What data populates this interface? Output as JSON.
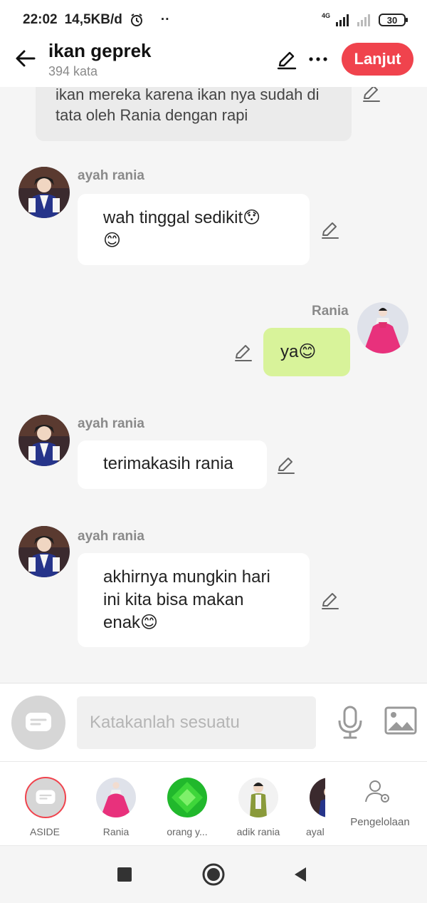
{
  "status_bar": {
    "time": "22:02",
    "speed": "14,5KB/d",
    "network": "4G",
    "battery": "30",
    "alarm_icon": "alarm-clock-icon",
    "dots": "··"
  },
  "header": {
    "title": "ikan geprek",
    "word_count": "394 kata",
    "next_label": "Lanjut"
  },
  "messages": [
    {
      "sender": "",
      "side": "left",
      "lines": [
        "ikan mereka karena ikan nya sudah di",
        "tata oleh Rania dengan rapi"
      ],
      "style": "narration"
    },
    {
      "sender": "ayah rania",
      "side": "left",
      "line1": "wah tinggal sedikit",
      "emoji": [
        "hushed-face-emoji",
        "smiling-face-emoji"
      ]
    },
    {
      "sender": "Rania",
      "side": "right",
      "text": "ya",
      "emoji": [
        "smiling-face-emoji"
      ]
    },
    {
      "sender": "ayah rania",
      "side": "left",
      "text": "terimakasih rania"
    },
    {
      "sender": "ayah rania",
      "side": "left",
      "lines": [
        "akhirnya mungkin hari",
        "ini kita bisa makan",
        "enak"
      ],
      "emoji": [
        "smiling-face-emoji"
      ]
    }
  ],
  "composer": {
    "placeholder": "Katakanlah sesuatu"
  },
  "characters": [
    {
      "label": "ASIDE",
      "selected": true
    },
    {
      "label": "Rania"
    },
    {
      "label": "orang y..."
    },
    {
      "label": "adik rania"
    },
    {
      "label": "ayal"
    },
    {
      "label": "Pengelolaan"
    }
  ],
  "colors": {
    "accent": "#f0434d",
    "self_bubble": "#d8f39a",
    "other_bubble": "#ffffff",
    "background": "#f5f5f5"
  }
}
